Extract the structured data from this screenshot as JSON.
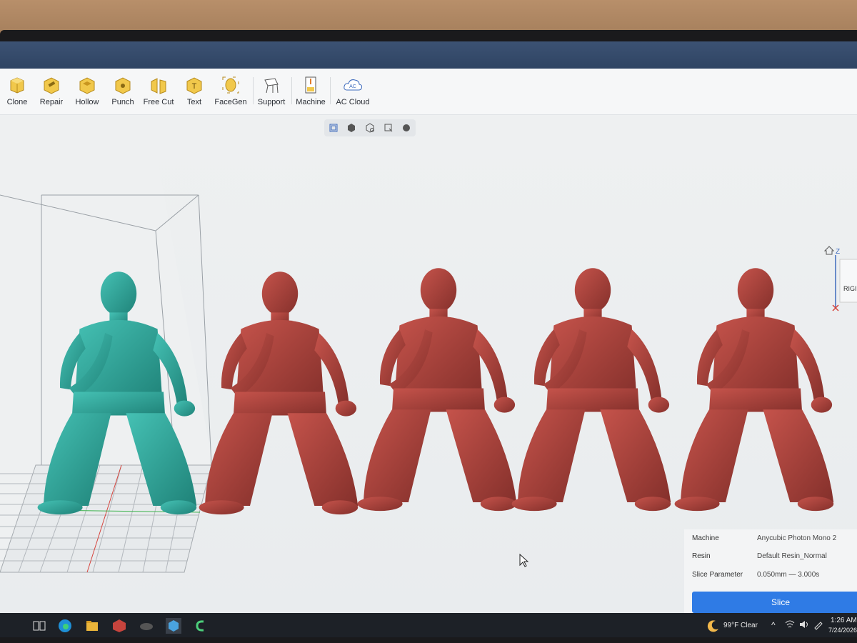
{
  "toolbar": {
    "items": [
      {
        "label": "Clone",
        "icon": "clone-icon"
      },
      {
        "label": "Repair",
        "icon": "repair-icon"
      },
      {
        "label": "Hollow",
        "icon": "hollow-icon"
      },
      {
        "label": "Punch",
        "icon": "punch-icon"
      },
      {
        "label": "Free Cut",
        "icon": "free-cut-icon"
      },
      {
        "label": "Text",
        "icon": "text-icon"
      },
      {
        "label": "FaceGen",
        "icon": "facegen-icon"
      },
      {
        "label": "Support",
        "icon": "support-icon"
      },
      {
        "label": "Machine",
        "icon": "machine-icon"
      },
      {
        "label": "AC Cloud",
        "icon": "ac-cloud-icon"
      }
    ],
    "cloud_badge": "AC"
  },
  "view_controls": [
    "view-cube-icon",
    "solid-view-icon",
    "wireframe-view-icon",
    "section-view-icon",
    "material-view-icon"
  ],
  "axis_gizmo": {
    "z_label": "Z",
    "side_label": "RIGI"
  },
  "info_panel": {
    "machine_label": "Machine",
    "machine_value": "Anycubic Photon Mono 2",
    "resin_label": "Resin",
    "resin_value": "Default Resin_Normal",
    "slice_param_label": "Slice Parameter",
    "slice_param_value": "0.050mm — 3.000s",
    "slice_button": "Slice"
  },
  "colors": {
    "selected_model": "#2ea79c",
    "unselected_model": "#a33a35",
    "accent": "#2f7be5"
  },
  "taskbar": {
    "weather": "99°F  Clear",
    "time": "1:26 AM",
    "date": "7/24/2026"
  }
}
